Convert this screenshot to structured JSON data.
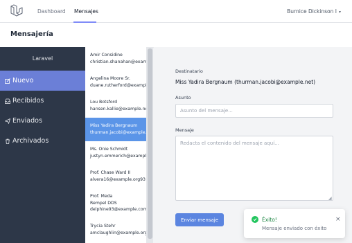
{
  "nav": {
    "links": [
      {
        "label": "Dashboard"
      },
      {
        "label": "Mensajes"
      }
    ],
    "user": "Burnice Dickinson I"
  },
  "page": {
    "title": "Mensajería"
  },
  "sidebar": {
    "title": "Laravel",
    "items": [
      {
        "label": "Nuevo",
        "icon": "edit-icon"
      },
      {
        "label": "Recibidos",
        "icon": "inbox-icon"
      },
      {
        "label": "Enviados",
        "icon": "send-icon"
      },
      {
        "label": "Archivados",
        "icon": "trash-icon"
      }
    ]
  },
  "messages": [
    {
      "name": "Amir Considine",
      "email": "christian.shanahan@example.org"
    },
    {
      "name": "Angelina Moore Sr.",
      "email": "duane.rutherford@example.net"
    },
    {
      "name": "Lou Botsford",
      "email": "hansen.kallie@example.net"
    },
    {
      "name": "Miss Yadira Bergnaum",
      "email": "thurman.jacobi@example.net"
    },
    {
      "name": "Ms. Onie Schmidt",
      "email": "justyn.emmerich@example.net"
    },
    {
      "name": "Prof. Chase Ward II",
      "email": "alvera16@example.org93"
    },
    {
      "name": "Prof. Meda Rempel DDS",
      "email": "delphine93@example.com"
    },
    {
      "name": "Trycia Stehr",
      "email": "amclaughlin@example.org"
    }
  ],
  "compose": {
    "recipient_label": "Destinatario",
    "recipient": "Miss Yadira Bergnaum (thurman.jacobi@example.net)",
    "subject_label": "Asunto",
    "subject_placeholder": "Asunto del mensaje...",
    "message_label": "Mensaje",
    "message_placeholder": "Redacta el contenido del mensaje aquí...",
    "send_label": "Enviar mensaje"
  },
  "toast": {
    "title": "Éxito!",
    "body": "Mensaje enviado con éxito",
    "close": "×"
  },
  "colors": {
    "sidebar_bg": "#2d3748",
    "sidebar_active": "#6b7fd7",
    "selected_message": "#5b95e8",
    "send_button": "#5b85e0",
    "success": "#22c55e"
  }
}
